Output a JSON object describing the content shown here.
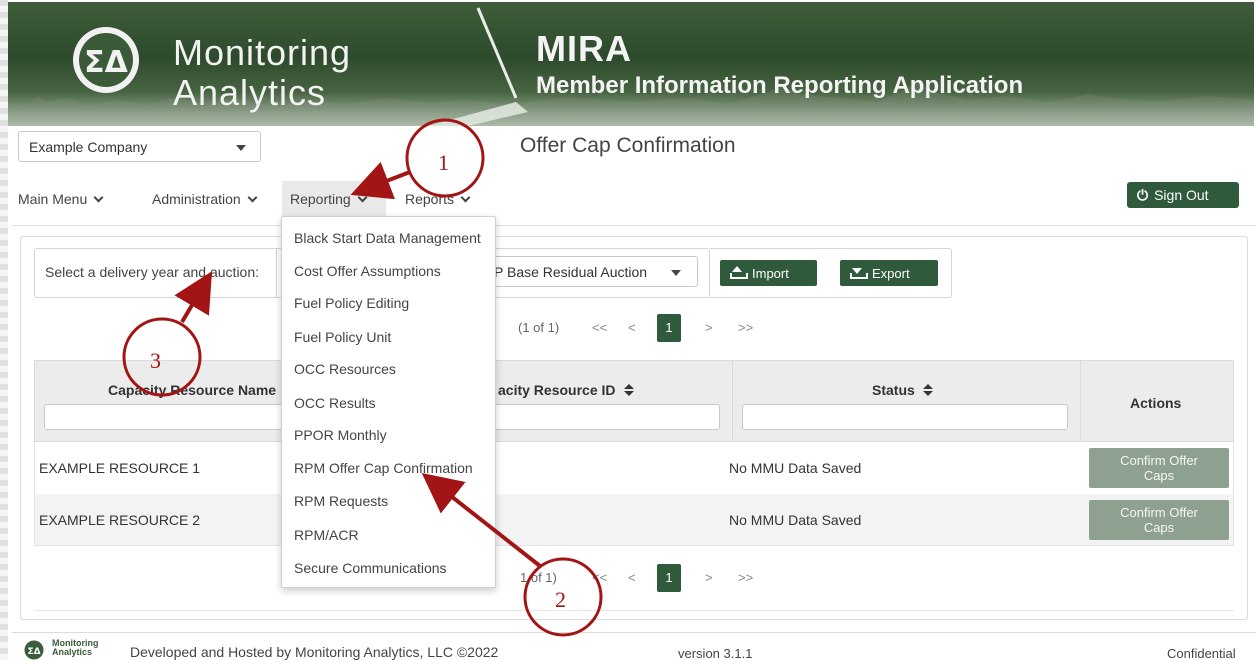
{
  "banner": {
    "brand_line1": "Monitoring",
    "brand_line2": "Analytics",
    "app_title": "MIRA",
    "app_subtitle": "Member Information Reporting Application"
  },
  "company_select": {
    "value": "Example Company"
  },
  "page_title": "Offer Cap Confirmation",
  "nav": {
    "items": [
      {
        "label": "Main Menu"
      },
      {
        "label": "Administration"
      },
      {
        "label": "Reporting"
      },
      {
        "label": "Reports"
      }
    ],
    "sign_out_label": "Sign Out"
  },
  "toolbar": {
    "select_label": "Select a delivery year and auction:",
    "auction_value": "P Base Residual Auction",
    "import_label": "Import",
    "export_label": "Export"
  },
  "pager": {
    "report": "(1 of 1)",
    "current_page": "1",
    "first": "<<",
    "prev": "<",
    "next": ">",
    "last": ">>"
  },
  "pager_bottom": {
    "report": "1 of 1)",
    "current_page": "1",
    "first": "<<",
    "prev": "<",
    "next": ">",
    "last": ">>"
  },
  "table": {
    "headers": {
      "name": "Capacity Resource Name",
      "id": "acity Resource ID",
      "status": "Status",
      "actions": "Actions"
    },
    "rows": [
      {
        "name": "EXAMPLE RESOURCE 1",
        "status": "No MMU Data Saved",
        "action_line1": "Confirm Offer",
        "action_line2": "Caps"
      },
      {
        "name": "EXAMPLE RESOURCE 2",
        "status": "No MMU Data Saved",
        "action_line1": "Confirm Offer",
        "action_line2": "Caps"
      }
    ]
  },
  "reporting_menu": {
    "items": [
      "Black Start Data Management",
      "Cost Offer Assumptions",
      "Fuel Policy Editing",
      "Fuel Policy Unit",
      "OCC Resources",
      "OCC Results",
      "PPOR Monthly",
      "RPM Offer Cap Confirmation",
      "RPM Requests",
      "RPM/ACR",
      "Secure Communications"
    ]
  },
  "footer": {
    "logo_line1": "Monitoring",
    "logo_line2": "Analytics",
    "developed": "Developed and Hosted by Monitoring Analytics, LLC ©2022",
    "version": "version 3.1.1",
    "confidential": "Confidential"
  },
  "annotations": {
    "n1": "1",
    "n2": "2",
    "n3": "3"
  },
  "colors": {
    "brand_green": "#2f5b3c",
    "annotation_red": "#a31414",
    "disabled_button": "#8ea190"
  }
}
